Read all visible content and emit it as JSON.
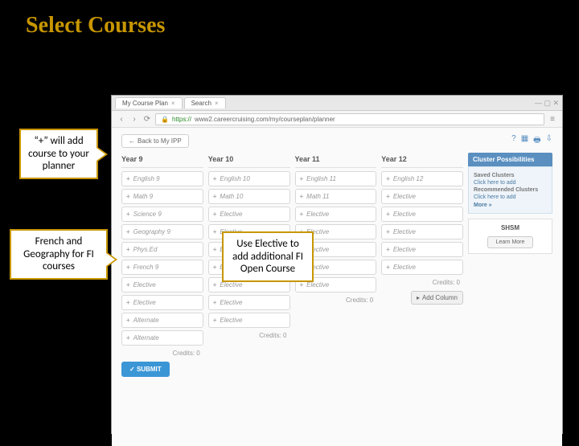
{
  "slide": {
    "title": "Select Courses"
  },
  "callouts": {
    "plus": "“+” will add course to your planner",
    "french": "French and Geography for FI courses",
    "elective": "Use Elective to add additional FI Open Course"
  },
  "browser": {
    "tabs": [
      {
        "label": "My Course Plan"
      },
      {
        "label": "Search"
      }
    ],
    "url_prefix": "https://",
    "url": "www2.careercruising.com/my/courseplan/planner",
    "back_button": "Back to My IPP"
  },
  "planner": {
    "years": [
      {
        "name": "Year 9",
        "slots": [
          "English 9",
          "Math 9",
          "Science 9",
          "Geography 9",
          "Phys.Ed",
          "French 9",
          "Elective",
          "Elective",
          "Alternate",
          "Alternate"
        ],
        "credits": "Credits: 0"
      },
      {
        "name": "Year 10",
        "slots": [
          "English 10",
          "Math 10",
          "Elective",
          "Elective",
          "Elective",
          "Elective",
          "Elective",
          "Elective",
          "Elective"
        ],
        "credits": "Credits: 0"
      },
      {
        "name": "Year 11",
        "slots": [
          "English 11",
          "Math 11",
          "Elective",
          "Elective",
          "Elective",
          "Elective",
          "Elective"
        ],
        "credits": "Credits: 0"
      },
      {
        "name": "Year 12",
        "slots": [
          "English 12",
          "Elective",
          "Elective",
          "Elective",
          "Elective",
          "Elective"
        ],
        "credits": "Credits: 0"
      }
    ],
    "submit": "SUBMIT",
    "add_column": "Add Column"
  },
  "sidebar": {
    "header": "Cluster Possibilities",
    "saved_label": "Saved Clusters",
    "saved_link": "Click here to add",
    "rec_label": "Recommended Clusters",
    "rec_link": "Click here to add",
    "more": "More »",
    "shsm_title": "SHSM",
    "shsm_button": "Learn More"
  }
}
